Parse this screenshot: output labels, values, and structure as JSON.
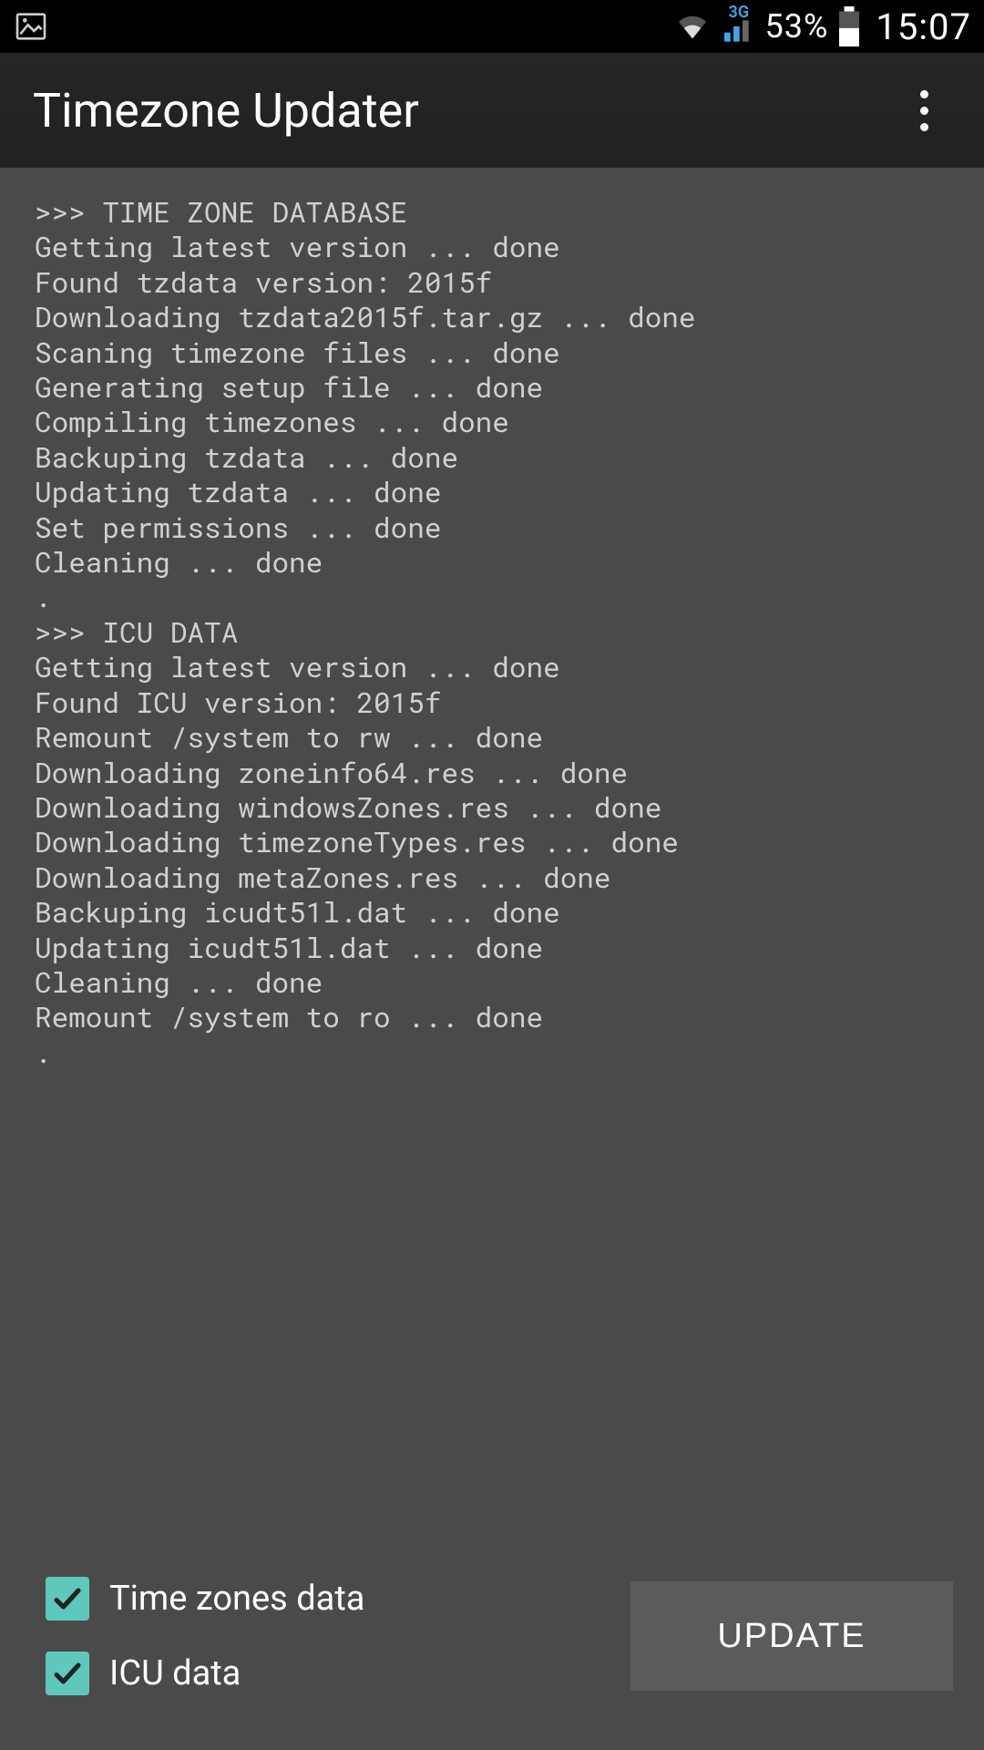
{
  "status_bar": {
    "network_label": "3G",
    "battery_percent": "53%",
    "clock": "15:07"
  },
  "app_bar": {
    "title": "Timezone Updater"
  },
  "log_lines": [
    ">>> TIME ZONE DATABASE",
    "Getting latest version ... done",
    "Found tzdata version: 2015f",
    "Downloading tzdata2015f.tar.gz ... done",
    "Scaning timezone files ... done",
    "Generating setup file ... done",
    "Compiling timezones ... done",
    "Backuping tzdata ... done",
    "Updating tzdata ... done",
    "Set permissions ... done",
    "Cleaning ... done",
    ".",
    ">>> ICU DATA",
    "Getting latest version ... done",
    "Found ICU version: 2015f",
    "Remount /system to rw ... done",
    "Downloading zoneinfo64.res ... done",
    "Downloading windowsZones.res ... done",
    "Downloading timezoneTypes.res ... done",
    "Downloading metaZones.res ... done",
    "Backuping icudt51l.dat ... done",
    "Updating icudt51l.dat ... done",
    "Cleaning ... done",
    "Remount /system to ro ... done",
    "."
  ],
  "controls": {
    "check_timezones_label": "Time zones data",
    "check_timezones_checked": true,
    "check_icu_label": "ICU data",
    "check_icu_checked": true,
    "update_button_label": "UPDATE"
  },
  "colors": {
    "accent": "#5ec8bd",
    "bg_dark": "#000000",
    "bg_content": "#4a4a4a",
    "bg_button": "#5b5b5b",
    "text_log": "#d0d0d0"
  }
}
